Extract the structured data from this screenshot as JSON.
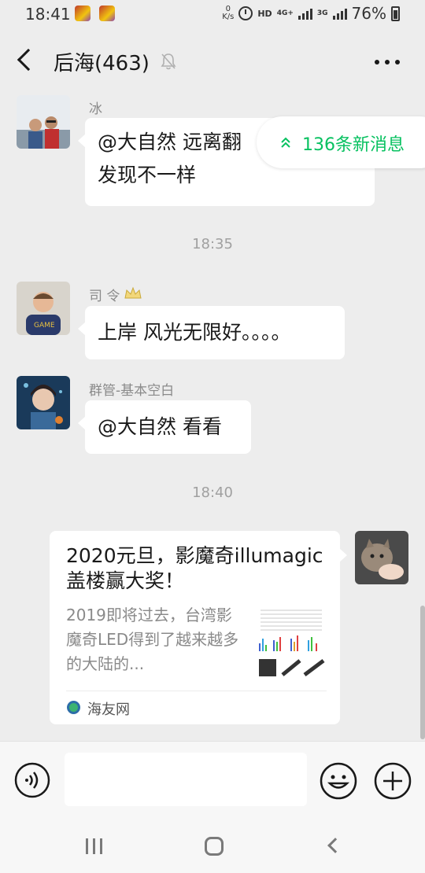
{
  "status_bar": {
    "time": "18:41",
    "speed_value": "0",
    "speed_unit": "K/s",
    "hd": "HD",
    "network_1": "4G+",
    "network_2": "3G",
    "battery": "76%"
  },
  "header": {
    "title": "后海(463)",
    "icons": [
      "back-icon",
      "mute-bell-icon",
      "more-icon"
    ]
  },
  "new_messages": {
    "label": "136条新消息",
    "color": "#07c160"
  },
  "messages": [
    {
      "sender": "冰",
      "text_line1": "@大自然 远离翻",
      "text_line2": "发现不一样"
    },
    {
      "sender": "司 令",
      "text": "上岸  风光无限好。。。。"
    },
    {
      "sender": "群管-基本空白",
      "text": "@大自然  看看"
    }
  ],
  "timestamps": [
    "18:35",
    "18:40"
  ],
  "link_card": {
    "title": "2020元旦，影魔奇illumagic盖楼赢大奖！",
    "description": "2019即将过去，台湾影魔奇LED得到了越来越多的大陆的...",
    "source": "海友网"
  },
  "input_bar": {
    "placeholder": "",
    "icons": [
      "voice-icon",
      "emoji-icon",
      "plus-icon"
    ]
  },
  "nav_bar": {
    "icons": [
      "recent-apps-icon",
      "home-icon",
      "back-nav-icon"
    ]
  },
  "colors": {
    "background": "#ededed",
    "bubble": "#ffffff",
    "accent_green": "#07c160"
  }
}
